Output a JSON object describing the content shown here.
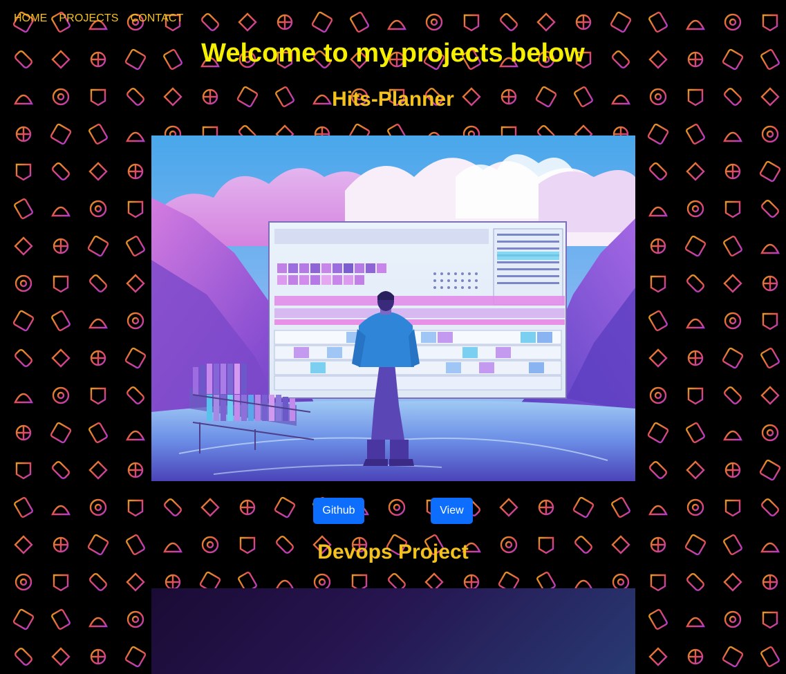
{
  "nav": {
    "home": "HOME",
    "projects": "PROJECTS",
    "contact": "CONTACT"
  },
  "heading": "Welcome to my projects below",
  "projects": [
    {
      "title": "Hits-Planner",
      "image_icon": "project-illustration",
      "buttons": {
        "github": "Github",
        "view": "View"
      }
    },
    {
      "title": "Devops Project",
      "image_icon": "project-illustration"
    }
  ],
  "colors": {
    "nav_text": "#f4c21c",
    "heading": "#f6f000",
    "project_title": "#f4c21c",
    "button": "#0d6efd",
    "background": "#000000"
  }
}
